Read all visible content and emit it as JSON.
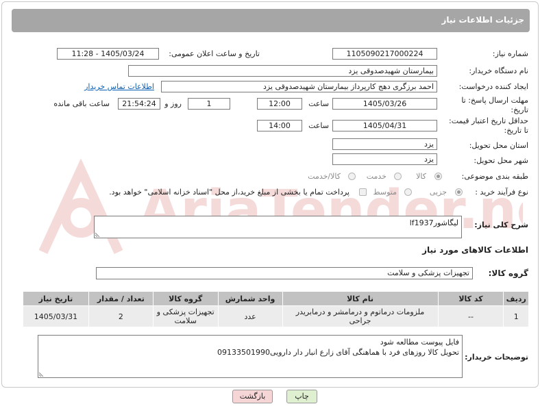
{
  "header": {
    "title": "جزئیات اطلاعات نیاز"
  },
  "form": {
    "need_number_label": "شماره نیاز:",
    "need_number": "1105090217000224",
    "announce_label": "تاریخ و ساعت اعلان عمومی:",
    "announce_value": "1405/03/24 - 11:28",
    "buyer_label": "نام دستگاه خریدار:",
    "buyer": "بیمارستان شهیدصدوقی یزد",
    "creator_label": "ایجاد کننده درخواست:",
    "creator": "احمد برزگری دهج کارپرداز بیمارستان شهیدصدوقی یزد",
    "contact_link": "اطلاعات تماس خریدار",
    "reply_deadline_label_1": "مهلت ارسال پاسخ: تا",
    "reply_deadline_label_2": "تاریخ:",
    "reply_date": "1405/03/26",
    "time_label": "ساعت",
    "reply_time": "12:00",
    "days_value": "1",
    "days_label": "روز و",
    "remaining_time": "21:54:24",
    "remaining_label": "ساعت باقی مانده",
    "price_deadline_label_1": "حداقل تاریخ اعتبار قیمت:",
    "price_deadline_label_2": "تا تاریخ:",
    "price_date": "1405/04/31",
    "price_time": "14:00",
    "province_label": "استان محل تحویل:",
    "province": "یزد",
    "city_label": "شهر محل تحویل:",
    "city": "یزد",
    "category_label": "طبقه بندی موضوعی:",
    "category_options": [
      "کالا",
      "خدمت",
      "کالا/خدمت"
    ],
    "category_selected": "کالا",
    "process_label": "نوع فرآیند خرید :",
    "process_options": [
      "جزیی",
      "متوسط"
    ],
    "process_selected": "جزیی",
    "payment_note": "پرداخت تمام یا بخشی از مبلغ خرید،از محل \"اسناد خزانه اسلامی\" خواهد بود."
  },
  "description": {
    "label": "شرح کلی نیاز:",
    "value": "لیگاشورlf1937"
  },
  "goods": {
    "section_title": "اطلاعات کالاهای مورد نیاز",
    "group_label": "گروه کالا:",
    "group_value": "تجهیزات پزشکی و سلامت"
  },
  "table": {
    "headers": [
      "ردیف",
      "کد کالا",
      "نام کالا",
      "واحد شمارش",
      "گروه کالا",
      "تعداد / مقدار",
      "تاریخ نیاز"
    ],
    "rows": [
      [
        "1",
        "--",
        "ملزومات درماتوم و درمامشر و درمابریدر جراحی",
        "عدد",
        "تجهیزات پزشکی و سلامت",
        "2",
        "1405/03/31"
      ]
    ]
  },
  "buyer_notes": {
    "label": "توضیحات خریدار:",
    "line1": "فایل پیوست مطالعه شود",
    "line2": "تحویل کالا روزهای فرد با هماهنگی آقای زارع انبار دار دارویی09133501990"
  },
  "buttons": {
    "print": "چاپ",
    "back": "بازگشت"
  },
  "watermark": {
    "text": "AriaTender.neT"
  }
}
